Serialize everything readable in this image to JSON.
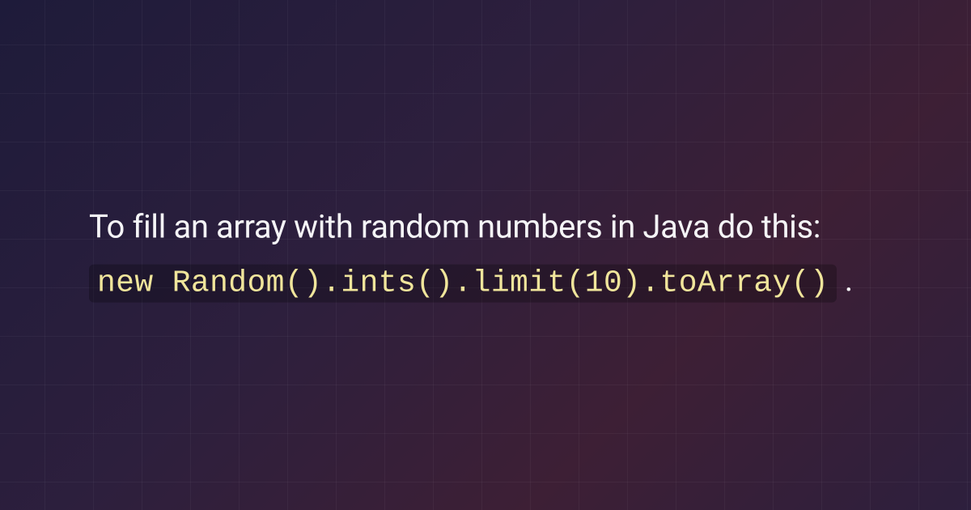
{
  "content": {
    "intro_text": "To fill an array with random numbers in Java do this: ",
    "code_snippet": "new Random().ints().limit(10).toArray()",
    "trailing_punct": "."
  }
}
